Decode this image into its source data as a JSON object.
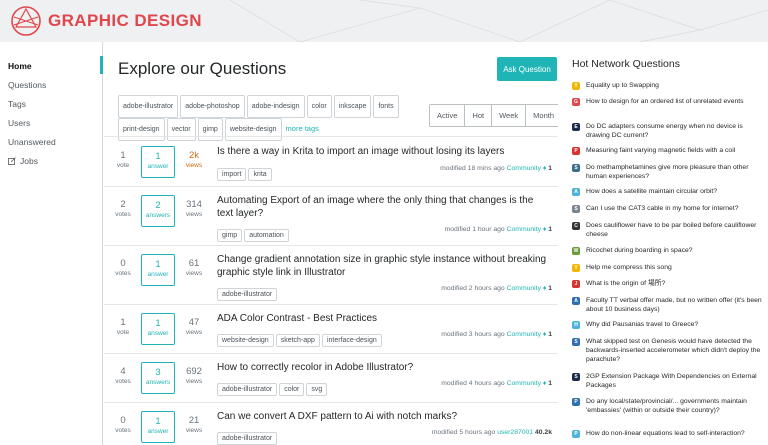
{
  "header": {
    "logo_text": "GRAPHIC DESIGN"
  },
  "nav": {
    "items": [
      {
        "label": "Home"
      },
      {
        "label": "Questions"
      },
      {
        "label": "Tags"
      },
      {
        "label": "Users"
      },
      {
        "label": "Unanswered"
      },
      {
        "label": "Jobs"
      }
    ]
  },
  "main": {
    "title": "Explore our Questions",
    "ask_button": "Ask Question",
    "popular_tags": [
      "adobe-illustrator",
      "adobe-photoshop",
      "adobe-indesign",
      "color",
      "inkscape",
      "fonts",
      "print-design",
      "vector",
      "gimp",
      "website-design"
    ],
    "more_tags": "more tags",
    "filters": [
      "Active",
      "Hot",
      "Week",
      "Month"
    ],
    "vote_label": "vote",
    "votes_label": "votes",
    "answer_label": "answer",
    "answers_label": "answers",
    "views_label": "views",
    "questions": [
      {
        "votes": "1",
        "votes_lbl": "vote",
        "answers": "1",
        "answers_lbl": "answer",
        "views": "2k",
        "title": "Is there a way in Krita to import an image without losing its layers",
        "tags": [
          "import",
          "krita"
        ],
        "meta": "modified 18 mins ago",
        "user": "Community ♦",
        "rep": "1"
      },
      {
        "votes": "2",
        "votes_lbl": "votes",
        "answers": "2",
        "answers_lbl": "answers",
        "views": "314",
        "title": "Automating Export of an image where the only thing that changes is the text layer?",
        "tags": [
          "gimp",
          "automation"
        ],
        "meta": "modified 1 hour ago",
        "user": "Community ♦",
        "rep": "1"
      },
      {
        "votes": "0",
        "votes_lbl": "votes",
        "answers": "1",
        "answers_lbl": "answer",
        "views": "61",
        "title": "Change gradient annotation size in graphic style instance without breaking graphic style link in Illustrator",
        "tags": [
          "adobe-illustrator"
        ],
        "meta": "modified 2 hours ago",
        "user": "Community ♦",
        "rep": "1"
      },
      {
        "votes": "1",
        "votes_lbl": "vote",
        "answers": "1",
        "answers_lbl": "answer",
        "views": "47",
        "title": "ADA Color Contrast - Best Practices",
        "tags": [
          "website-design",
          "sketch-app",
          "interface-design"
        ],
        "meta": "modified 3 hours ago",
        "user": "Community ♦",
        "rep": "1"
      },
      {
        "votes": "4",
        "votes_lbl": "votes",
        "answers": "3",
        "answers_lbl": "answers",
        "views": "692",
        "title": "How to correctly recolor in Adobe Illustrator?",
        "tags": [
          "adobe-illustrator",
          "color",
          "svg"
        ],
        "meta": "modified 4 hours ago",
        "user": "Community ♦",
        "rep": "1"
      },
      {
        "votes": "0",
        "votes_lbl": "votes",
        "answers": "1",
        "answers_lbl": "answer",
        "views": "21",
        "title": "Can we convert A DXF pattern to Ai with notch marks?",
        "tags": [
          "adobe-illustrator"
        ],
        "meta": "modified 5 hours ago",
        "user": "user287001",
        "rep": "40.2k"
      }
    ]
  },
  "hot": {
    "title": "Hot Network Questions",
    "items": [
      {
        "text": "Equality up to Swapping",
        "color": "#f2b705",
        "glyph": "Y"
      },
      {
        "text": "How to design for an ordered list of unrelated events",
        "color": "#e0474c",
        "glyph": "G"
      },
      {
        "text": "Do DC adapters consume energy when no device is drawing DC current?",
        "color": "#1a2b4c",
        "glyph": "E"
      },
      {
        "text": "Measuring faint varying magnetic fields with a coil",
        "color": "#d9322f",
        "glyph": "P"
      },
      {
        "text": "Do methamphetamines give more pleasure than other human experiences?",
        "color": "#3a6f8f",
        "glyph": "S"
      },
      {
        "text": "How does a satellite maintain circular orbit?",
        "color": "#4fb3d9",
        "glyph": "A"
      },
      {
        "text": "Can I use the CAT3 cable in my home for internet?",
        "color": "#7a8590",
        "glyph": "S"
      },
      {
        "text": "Does cauliflower have to be par boiled before cauliflower cheese",
        "color": "#333333",
        "glyph": "C"
      },
      {
        "text": "Ricochet during boarding in space?",
        "color": "#6a9a3a",
        "glyph": "W"
      },
      {
        "text": "Help me compress this song",
        "color": "#f2b705",
        "glyph": "Y"
      },
      {
        "text": "What is the origin of 場所?",
        "color": "#d9322f",
        "glyph": "J"
      },
      {
        "text": "Faculty TT verbal offer made, but no written offer (it's been about 10 business days)",
        "color": "#2f6fb0",
        "glyph": "A"
      },
      {
        "text": "Why did Pausanias travel to Greece?",
        "color": "#4fb3d9",
        "glyph": "H"
      },
      {
        "text": "What skipped test on Genesis would have detected the backwards-inserted accelerometer which didn't deploy the parachute?",
        "color": "#2f6fb0",
        "glyph": "S"
      },
      {
        "text": "2GP Extension Package With Dependencies on External Packages",
        "color": "#1a2b4c",
        "glyph": "S"
      },
      {
        "text": "Do any local/state/provincial/... governments maintain 'embassies' (within or outside their country)?",
        "color": "#2f6fb0",
        "glyph": "P"
      },
      {
        "text": "How do non-linear equations lead to self-interaction?",
        "color": "#4fb3d9",
        "glyph": "P"
      }
    ]
  }
}
